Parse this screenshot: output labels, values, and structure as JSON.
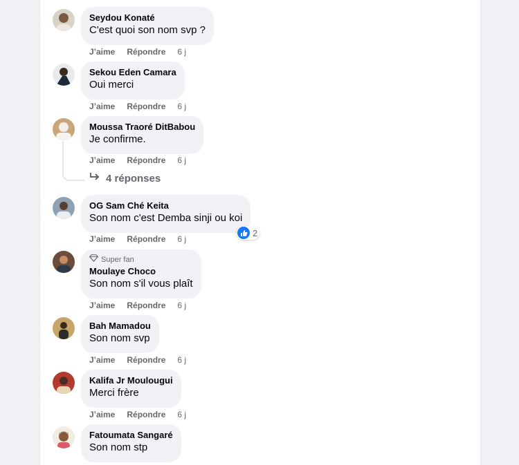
{
  "actions": {
    "like": "J’aime",
    "reply": "Répondre"
  },
  "comments": [
    {
      "author": "Seydou Konaté",
      "text": "C'est quoi son nom svp ?",
      "time": "6 j"
    },
    {
      "author": "Sekou Eden Camara",
      "text": "Oui merci",
      "time": "6 j"
    },
    {
      "author": "Moussa Traoré DitBabou",
      "text": "Je confirme.",
      "time": "6 j",
      "replies": "4 réponses"
    },
    {
      "author": "OG Sam Ché Keita",
      "text": "Son nom c'est Demba sinji ou koi",
      "time": "6 j",
      "reaction_count": "2"
    },
    {
      "badge": "Super fan",
      "author": "Moulaye Choco",
      "text": "Son nom s'il vous plaît",
      "time": "6 j"
    },
    {
      "author": "Bah Mamadou",
      "text": "Son nom svp",
      "time": "6 j"
    },
    {
      "author": "Kalifa Jr Moulougui",
      "text": "Merci frère",
      "time": "6 j"
    },
    {
      "author": "Fatoumata Sangaré",
      "text": "Son nom stp"
    }
  ],
  "colors": {
    "bubble": "#f0f2f5",
    "like_blue": "#1877f2",
    "meta_gray": "#65676b"
  }
}
